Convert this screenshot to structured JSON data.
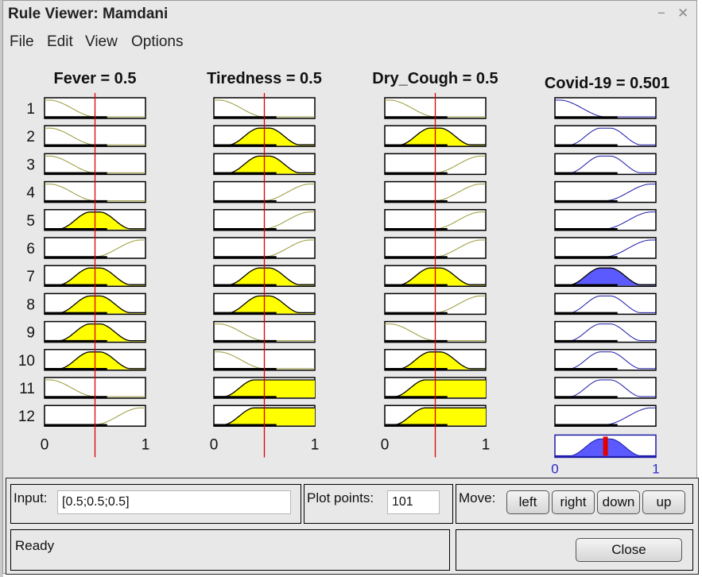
{
  "window": {
    "title": "Rule Viewer: Mamdani",
    "minimize_glyph": "−",
    "close_glyph": "✕"
  },
  "menu": [
    "File",
    "Edit",
    "View",
    "Options"
  ],
  "inputs": [
    {
      "label": "Fever = 0.5",
      "mfs": [
        "low",
        "low",
        "low",
        "low",
        "mid",
        "high",
        "mid",
        "mid",
        "mid",
        "mid",
        "low",
        "high"
      ],
      "filled": [
        false,
        false,
        false,
        false,
        true,
        false,
        true,
        true,
        true,
        true,
        false,
        false
      ]
    },
    {
      "label": "Tiredness = 0.5",
      "mfs": [
        "low",
        "mid",
        "mid",
        "high",
        "high",
        "high",
        "mid",
        "mid",
        "low",
        "low",
        "plateau",
        "plateau"
      ],
      "filled": [
        false,
        true,
        true,
        false,
        false,
        false,
        true,
        true,
        false,
        false,
        true,
        true
      ]
    },
    {
      "label": "Dry_Cough = 0.5",
      "mfs": [
        "low",
        "mid",
        "high",
        "high",
        "high",
        "high",
        "mid",
        "high",
        "low",
        "mid",
        "plateau",
        "plateau"
      ],
      "filled": [
        false,
        true,
        false,
        false,
        false,
        false,
        true,
        false,
        false,
        true,
        true,
        true
      ]
    }
  ],
  "output": {
    "label": "Covid-19 = 0.501",
    "mfs": [
      "low",
      "mid",
      "mid",
      "high",
      "high",
      "high",
      "mid",
      "mid",
      "mid",
      "mid",
      "mid",
      "high"
    ],
    "filled": [
      false,
      false,
      false,
      false,
      false,
      false,
      true,
      false,
      false,
      false,
      false,
      false
    ],
    "aggregate_value": 0.501,
    "range": [
      "0",
      "1"
    ]
  },
  "rule_numbers": [
    "1",
    "2",
    "3",
    "4",
    "5",
    "6",
    "7",
    "8",
    "9",
    "10",
    "11",
    "12"
  ],
  "input_range": [
    "0",
    "1"
  ],
  "input_value": 0.5,
  "colors": {
    "input_fill": "#ffff00",
    "output_fill": "#5a5aff",
    "index_line": "#e00000",
    "mf_line_in": "#9a9a3a",
    "mf_line_out": "#1a1aa8"
  },
  "controls": {
    "input_label": "Input:",
    "input_value": "[0.5;0.5;0.5]",
    "plot_points_label": "Plot points:",
    "plot_points_value": "101",
    "move_label": "Move:",
    "move_buttons": [
      "left",
      "right",
      "down",
      "up"
    ],
    "status": "Ready",
    "close_label": "Close"
  }
}
